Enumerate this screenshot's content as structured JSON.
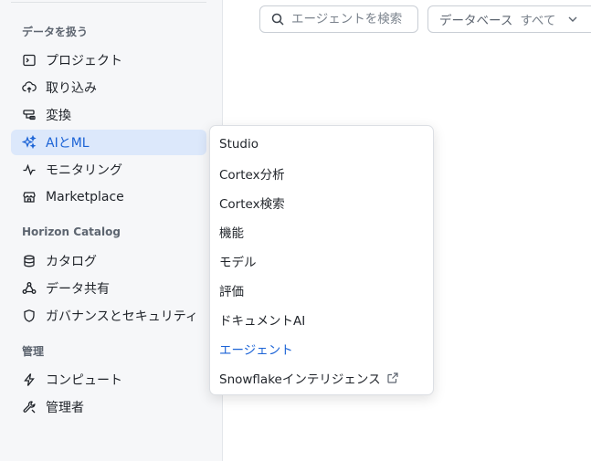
{
  "sidebar": {
    "sections": [
      {
        "title": "データを扱う",
        "items": [
          {
            "label": "プロジェクト",
            "icon": "terminal-icon"
          },
          {
            "label": "取り込み",
            "icon": "cloud-upload-icon"
          },
          {
            "label": "変換",
            "icon": "transform-icon"
          },
          {
            "label": "AIとML",
            "icon": "sparkle-icon",
            "active": true
          },
          {
            "label": "モニタリング",
            "icon": "pulse-icon"
          },
          {
            "label": "Marketplace",
            "icon": "storefront-icon"
          }
        ]
      },
      {
        "title": "Horizon Catalog",
        "items": [
          {
            "label": "カタログ",
            "icon": "database-icon"
          },
          {
            "label": "データ共有",
            "icon": "share-icon"
          },
          {
            "label": "ガバナンスとセキュリティ",
            "icon": "shield-icon"
          }
        ]
      },
      {
        "title": "管理",
        "items": [
          {
            "label": "コンピュート",
            "icon": "lightning-icon"
          },
          {
            "label": "管理者",
            "icon": "wrench-icon"
          }
        ]
      }
    ]
  },
  "search": {
    "placeholder": "エージェントを検索"
  },
  "database_filter": {
    "label": "データベース",
    "value": "すべて"
  },
  "submenu": {
    "items": [
      {
        "label": "Studio"
      },
      {
        "label": "Cortex分析"
      },
      {
        "label": "Cortex検索"
      },
      {
        "label": "機能"
      },
      {
        "label": "モデル"
      },
      {
        "label": "評価"
      },
      {
        "label": "ドキュメントAI"
      },
      {
        "label": "エージェント",
        "active": true
      },
      {
        "label": "Snowflakeインテリジェンス",
        "external": true
      }
    ]
  },
  "colors": {
    "accent": "#1b63d6",
    "active_bg": "#dce8fb",
    "sidebar_bg": "#f6f7f9"
  }
}
